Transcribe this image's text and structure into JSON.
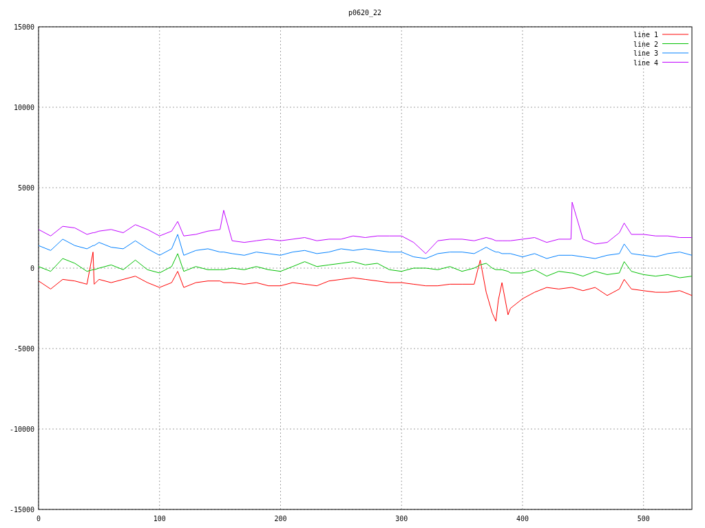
{
  "chart_data": {
    "type": "line",
    "title": "p0620_22",
    "x": [
      0,
      10,
      20,
      30,
      40,
      45,
      46,
      50,
      60,
      70,
      80,
      90,
      100,
      110,
      115,
      120,
      130,
      140,
      150,
      153,
      160,
      170,
      180,
      190,
      200,
      210,
      220,
      230,
      240,
      250,
      260,
      270,
      280,
      290,
      300,
      310,
      320,
      330,
      340,
      350,
      360,
      365,
      370,
      375,
      378,
      380,
      383,
      388,
      390,
      400,
      410,
      420,
      430,
      440,
      441,
      450,
      460,
      470,
      480,
      484,
      490,
      500,
      510,
      520,
      530,
      540
    ],
    "series": [
      {
        "name": "line 1",
        "color": "#ff0000",
        "values": [
          -800,
          -1300,
          -700,
          -800,
          -1000,
          1000,
          -1000,
          -700,
          -900,
          -700,
          -500,
          -900,
          -1200,
          -900,
          -200,
          -1200,
          -900,
          -800,
          -800,
          -900,
          -900,
          -1000,
          -900,
          -1100,
          -1100,
          -900,
          -1000,
          -1100,
          -800,
          -700,
          -600,
          -700,
          -800,
          -900,
          -900,
          -1000,
          -1100,
          -1100,
          -1000,
          -1000,
          -1000,
          500,
          -1500,
          -2800,
          -3300,
          -2000,
          -900,
          -2900,
          -2500,
          -1900,
          -1500,
          -1200,
          -1300,
          -1200,
          -1200,
          -1400,
          -1200,
          -1700,
          -1300,
          -700,
          -1300,
          -1400,
          -1500,
          -1500,
          -1400,
          -1700
        ]
      },
      {
        "name": "line 2",
        "color": "#00c000",
        "values": [
          100,
          -200,
          600,
          300,
          -200,
          -100,
          -100,
          0,
          200,
          -100,
          500,
          -100,
          -300,
          100,
          900,
          -200,
          100,
          -100,
          -100,
          -100,
          0,
          -100,
          100,
          -100,
          -200,
          100,
          400,
          100,
          200,
          300,
          400,
          200,
          300,
          -100,
          -200,
          0,
          0,
          -100,
          100,
          -200,
          0,
          200,
          300,
          0,
          -100,
          -100,
          -100,
          -200,
          -300,
          -300,
          -100,
          -500,
          -200,
          -300,
          -300,
          -500,
          -200,
          -400,
          -300,
          400,
          -200,
          -400,
          -500,
          -400,
          -600,
          -500
        ]
      },
      {
        "name": "line 3",
        "color": "#0080ff",
        "values": [
          1400,
          1100,
          1800,
          1400,
          1200,
          1400,
          1400,
          1600,
          1300,
          1200,
          1700,
          1200,
          800,
          1200,
          2100,
          800,
          1100,
          1200,
          1000,
          1000,
          900,
          800,
          1000,
          900,
          800,
          1000,
          1100,
          900,
          1000,
          1200,
          1100,
          1200,
          1100,
          1000,
          1000,
          700,
          600,
          900,
          1000,
          1000,
          900,
          1100,
          1300,
          1100,
          1000,
          1000,
          900,
          900,
          900,
          700,
          900,
          600,
          800,
          800,
          800,
          700,
          600,
          800,
          900,
          1500,
          900,
          800,
          700,
          900,
          1000,
          800
        ]
      },
      {
        "name": "line 4",
        "color": "#c000ff",
        "values": [
          2400,
          2000,
          2600,
          2500,
          2100,
          2200,
          2200,
          2300,
          2400,
          2200,
          2700,
          2400,
          2000,
          2300,
          2900,
          2000,
          2100,
          2300,
          2400,
          3600,
          1700,
          1600,
          1700,
          1800,
          1700,
          1800,
          1900,
          1700,
          1800,
          1800,
          2000,
          1900,
          2000,
          2000,
          2000,
          1600,
          900,
          1700,
          1800,
          1800,
          1700,
          1800,
          1900,
          1800,
          1700,
          1700,
          1700,
          1700,
          1700,
          1800,
          1900,
          1600,
          1800,
          1800,
          4100,
          1800,
          1500,
          1600,
          2200,
          2800,
          2100,
          2100,
          2000,
          2000,
          1900,
          1900
        ]
      }
    ],
    "xlim": [
      0,
      540
    ],
    "ylim": [
      -15000,
      15000
    ],
    "xticks": [
      0,
      100,
      200,
      300,
      400,
      500
    ],
    "yticks": [
      -15000,
      -10000,
      -5000,
      0,
      5000,
      10000,
      15000
    ],
    "grid": true,
    "legend": true
  }
}
